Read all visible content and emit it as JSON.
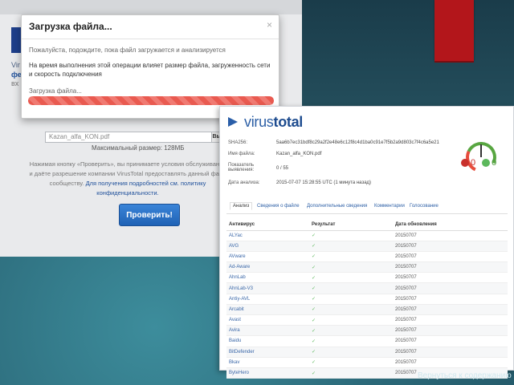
{
  "modal": {
    "title": "Загрузка файла...",
    "close": "×",
    "text1": "Пожалуйста, подождите, пока файл загружается и анализируется",
    "text2": "На время выполнения этой операции влияет размер файла, загруженность сети и скорость подключения",
    "status": "Загрузка файла...",
    "progress": 1.0
  },
  "upload_page": {
    "side_a": "Vir",
    "side_b": "фе",
    "side_c": "вх",
    "file_name": "Kazan_alfa_KON.pdf",
    "browse": "Вы",
    "max_size": "Максимальный размер: 128МБ",
    "terms": "Нажимая кнопку «Проверить», вы принимаете условия обслуживания и даёте разрешение компании VirusTotal предоставлять данный файл сообществу.",
    "terms_link": "Для получения подробностей см. политику конфиденциальности.",
    "check_button": "Проверить!"
  },
  "result": {
    "logo_a": "virus",
    "logo_b": "total",
    "info": [
      {
        "k": "SHA256:",
        "v": "5aa6b7ec31bdf8c29a2f2e48e6c12f8c4d1ba0c91e7f5b2a9d803c7f4c6a5e21"
      },
      {
        "k": "Имя файла:",
        "v": "Kazan_alfa_KON.pdf"
      },
      {
        "k": "Показатель выявления:",
        "v": "0 / 55"
      },
      {
        "k": "Дата анализа:",
        "v": "2015-07-07 15:28:55 UTC (1 минута назад)"
      }
    ],
    "bad_count": "0",
    "good_count": "0",
    "tabs": [
      "Анализ",
      "Сведения о файле",
      "Дополнительные сведения",
      "Комментарии",
      "Голосование"
    ],
    "headers": [
      "Антивирус",
      "Результат",
      "Дата обновления"
    ],
    "rows": [
      {
        "av": "ALYac",
        "res": "✓",
        "date": "20150707"
      },
      {
        "av": "AVG",
        "res": "✓",
        "date": "20150707"
      },
      {
        "av": "AVware",
        "res": "✓",
        "date": "20150707"
      },
      {
        "av": "Ad-Aware",
        "res": "✓",
        "date": "20150707"
      },
      {
        "av": "AhnLab",
        "res": "✓",
        "date": "20150707"
      },
      {
        "av": "AhnLab-V3",
        "res": "✓",
        "date": "20150707"
      },
      {
        "av": "Antiy-AVL",
        "res": "✓",
        "date": "20150707"
      },
      {
        "av": "Arcabit",
        "res": "✓",
        "date": "20150707"
      },
      {
        "av": "Avast",
        "res": "✓",
        "date": "20150707"
      },
      {
        "av": "Avira",
        "res": "✓",
        "date": "20150707"
      },
      {
        "av": "Baidu",
        "res": "✓",
        "date": "20150707"
      },
      {
        "av": "BitDefender",
        "res": "✓",
        "date": "20150707"
      },
      {
        "av": "Bkav",
        "res": "✓",
        "date": "20150707"
      },
      {
        "av": "ByteHero",
        "res": "✓",
        "date": "20150707"
      }
    ]
  },
  "back_link": "Вернуться к содержанию"
}
